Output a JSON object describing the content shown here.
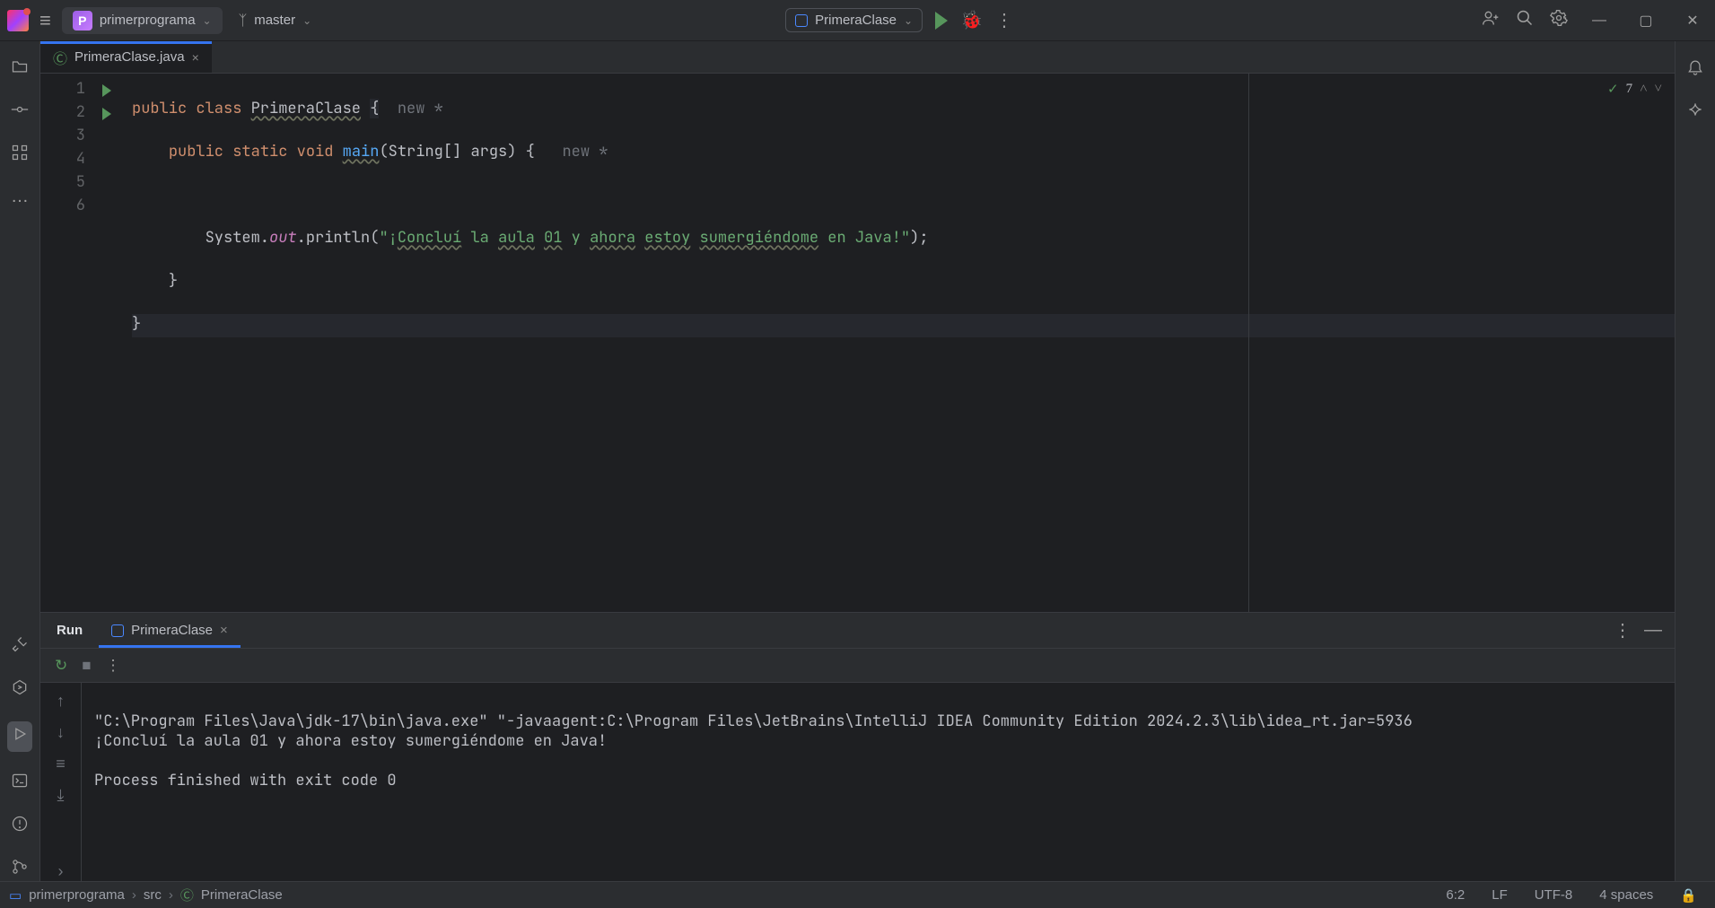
{
  "titlebar": {
    "project_letter": "P",
    "project_name": "primerprograma",
    "branch": "master",
    "run_config": "PrimeraClase"
  },
  "tabs": {
    "file": "PrimeraClase.java"
  },
  "editor": {
    "lines": [
      "1",
      "2",
      "3",
      "4",
      "5",
      "6"
    ],
    "l1": {
      "kw1": "public",
      "kw2": "class",
      "cls": "PrimeraClase",
      "brace": "{",
      "hint": "  new *"
    },
    "l2": {
      "indent": "    ",
      "kw1": "public",
      "kw2": "static",
      "kw3": "void",
      "mth": "main",
      "sig": "(String[] args) {",
      "hint": "   new *"
    },
    "l3": "",
    "l4": {
      "indent": "        ",
      "pre": "System.",
      "fld": "out",
      "mid": ".println(",
      "q1": "\"",
      "txt1": "¡",
      "w1": "Concluí",
      "sp1": " la ",
      "w2": "aula",
      "sp2": " ",
      "w3": "01",
      "sp3": " y ",
      "w4": "ahora",
      "sp4": " ",
      "w5": "estoy",
      "sp5": " ",
      "w6": "sumergiéndome",
      "txt2": " en Java!",
      "q2": "\"",
      "end": ");"
    },
    "l5": {
      "indent": "    ",
      "brace": "}"
    },
    "l6": {
      "brace": "}"
    },
    "inspection_count": "7"
  },
  "run": {
    "title": "Run",
    "tab": "PrimeraClase",
    "out_line1": "\"C:\\Program Files\\Java\\jdk-17\\bin\\java.exe\" \"-javaagent:C:\\Program Files\\JetBrains\\IntelliJ IDEA Community Edition 2024.2.3\\lib\\idea_rt.jar=5936",
    "out_line2": "¡Concluí la aula 01 y ahora estoy sumergiéndome en Java!",
    "out_line3": "",
    "out_line4": "Process finished with exit code 0"
  },
  "status": {
    "crumb1": "primerprograma",
    "crumb2": "src",
    "crumb3": "PrimeraClase",
    "caret": "6:2",
    "eol": "LF",
    "enc": "UTF-8",
    "indent": "4 spaces"
  }
}
